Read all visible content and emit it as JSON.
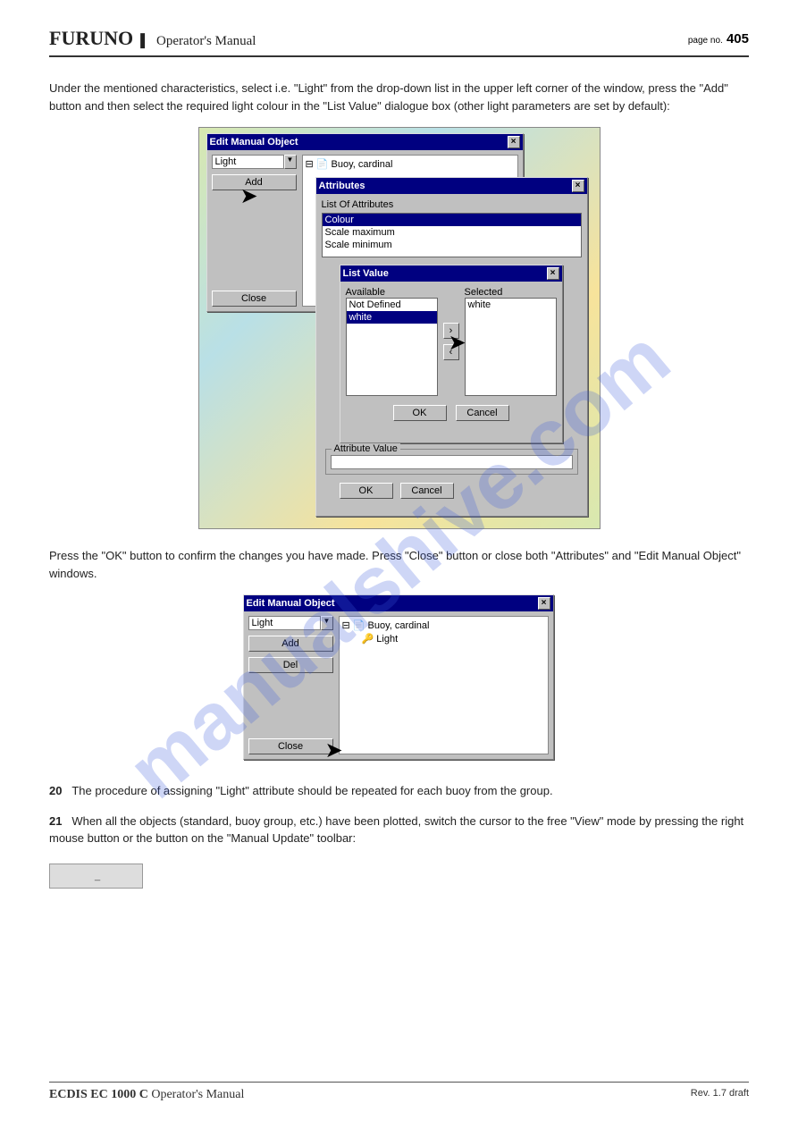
{
  "header": {
    "brand": "FURUNO",
    "section": "Operator's Manual",
    "page_label": "page no.",
    "page_num": "405"
  },
  "para1": "Under the mentioned characteristics, select i.e. \"Light\" from the drop-down list in the upper left corner of the window, press the \"Add\" button and then select the required light colour in the \"List Value\" dialogue box (other light parameters are set by default):",
  "shot1": {
    "win_main_title": "Edit Manual Object",
    "combo_value": "Light",
    "btn_add": "Add",
    "btn_close": "Close",
    "tree_root": "Buoy, cardinal",
    "win_attr_title": "Attributes",
    "attr_list_label": "List Of Attributes",
    "attr_items": [
      "Colour",
      "Scale maximum",
      "Scale minimum"
    ],
    "attr_value_label": "Attribute Value",
    "btn_ok": "OK",
    "btn_cancel": "Cancel",
    "win_listvalue_title": "List Value",
    "label_available": "Available",
    "label_selected": "Selected",
    "available_items": [
      "Not Defined",
      "white"
    ],
    "selected_items": [
      "white"
    ],
    "lv_btn_ok": "OK",
    "lv_btn_cancel": "Cancel"
  },
  "para2": "Press the \"OK\" button to confirm the changes you have made. Press \"Close\" button or close both \"Attributes\" and \"Edit Manual Object\" windows.",
  "shot2": {
    "win_main_title": "Edit Manual Object",
    "combo_value": "Light",
    "btn_add": "Add",
    "btn_del": "Del",
    "btn_close": "Close",
    "tree_root": "Buoy, cardinal",
    "tree_child": "Light"
  },
  "step20_num": "20",
  "step20_text": "The procedure of assigning \"Light\" attribute should be repeated for each buoy from the group.",
  "step21_num": "21",
  "step21_text": "When all the objects (standard, buoy group, etc.) have been plotted, switch the cursor to the free \"View\" mode by pressing the right mouse button or the button on the \"Manual Update\" toolbar:",
  "inline_button_caption": "(button image)",
  "footer": {
    "product": "ECDIS EC 1000 C",
    "doc": " Operator's Manual",
    "rev": "Rev.  1.7 draft"
  }
}
